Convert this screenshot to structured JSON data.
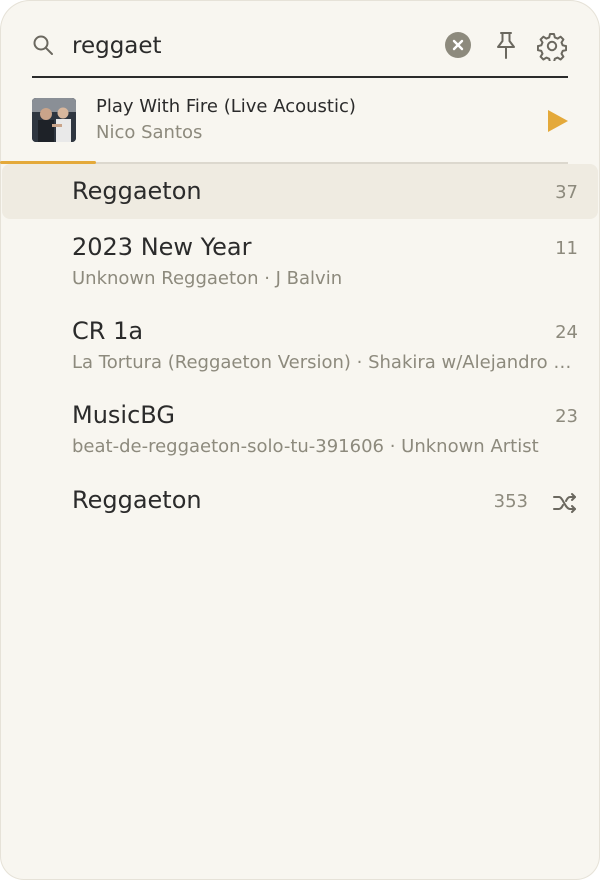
{
  "search": {
    "value": "reggaet",
    "icons": {
      "search": "search-icon",
      "clear": "clear-circle-icon",
      "pin": "pin-icon",
      "settings": "gear-icon"
    }
  },
  "now_playing": {
    "title": "Play With Fire (Live Acoustic)",
    "artist": "Nico Santos",
    "progress": 0.16,
    "play_icon": "play-icon",
    "accent": "#e4a93a"
  },
  "results": [
    {
      "title": "Reggaeton",
      "subtitle": "",
      "count": "37",
      "selected": true
    },
    {
      "title": "2023 New Year",
      "subtitle": "Unknown Reggaeton · J Balvin",
      "count": "11"
    },
    {
      "title": "CR 1a",
      "subtitle": "La Tortura (Reggaeton Version) · Shakira w/Alejandro Sanz",
      "count": "24"
    },
    {
      "title": "MusicBG",
      "subtitle": "beat-de-reggaeton-solo-tu-391606 · Unknown Artist",
      "count": "23"
    },
    {
      "title": "Reggaeton",
      "subtitle": "",
      "count": "353",
      "icon": "shuffle-icon"
    }
  ],
  "colors": {
    "background": "#f8f6f0",
    "text": "#2b2b2b",
    "muted": "#8d8a7d",
    "selected_row": "#efebe1"
  }
}
